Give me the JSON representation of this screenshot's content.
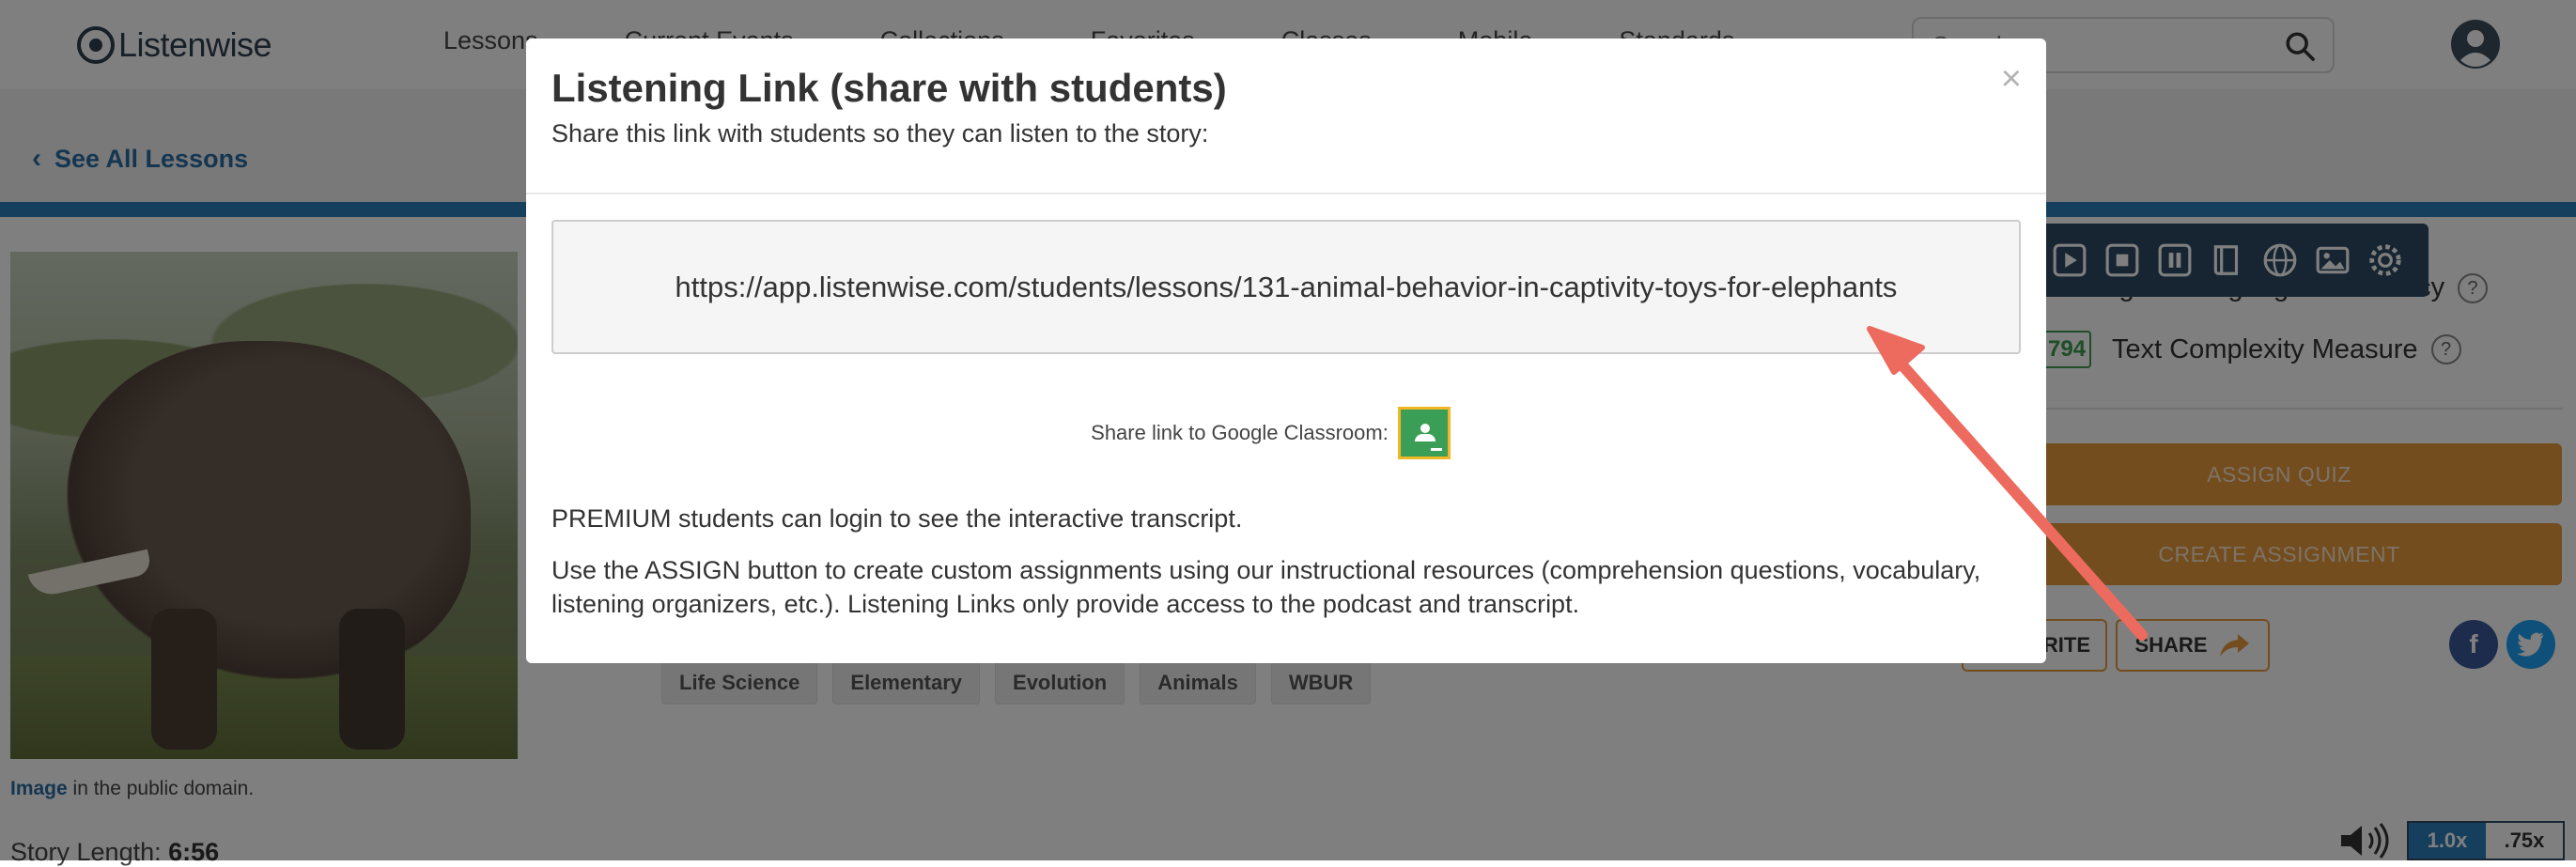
{
  "nav": {
    "logo_text": "Listenwise",
    "links": [
      "Lessons",
      "Current Events",
      "Collections",
      "Favorites",
      "Classes",
      "Mobile",
      "Standards"
    ],
    "search_placeholder": "Search"
  },
  "subnav": {
    "back_label": "See All Lessons"
  },
  "lesson": {
    "image_credit_link": "Image",
    "image_credit_rest": " in the public domain.",
    "story_length_label": "Story Length:",
    "story_length_value": "6:56",
    "tags": [
      "Life Science",
      "Elementary",
      "Evolution",
      "Animals",
      "WBUR"
    ]
  },
  "sidebar": {
    "proficiency_label": "English Language Proficiency",
    "tcm_value": "794",
    "tcm_label": "Text Complexity Measure",
    "help": "?",
    "assign_quiz": "ASSIGN QUIZ",
    "create_assignment": "CREATE ASSIGNMENT",
    "favorite_label": "RITE",
    "share_label": "SHARE",
    "facebook": "f"
  },
  "player": {
    "speeds": [
      "1.0x",
      ".75x"
    ]
  },
  "modal": {
    "title": "Listening Link (share with students)",
    "subtitle": "Share this link with students so they can listen to the story:",
    "close": "×",
    "link_url": "https://app.listenwise.com/students/lessons/131-animal-behavior-in-captivity-toys-for-elephants",
    "gc_label": "Share link to Google Classroom:",
    "p1": "PREMIUM students can login to see the interactive transcript.",
    "p2": "Use the ASSIGN button to create custom assignments using our instructional resources (comprehension questions, vocabulary, listening organizers, etc.). Listening Links only provide access to the podcast and transcript."
  },
  "colors": {
    "accent_blue": "#2b7fb8",
    "orange": "#e69a3c",
    "annotation_arrow": "#ec6a5e",
    "google_green": "#3a9e57"
  }
}
